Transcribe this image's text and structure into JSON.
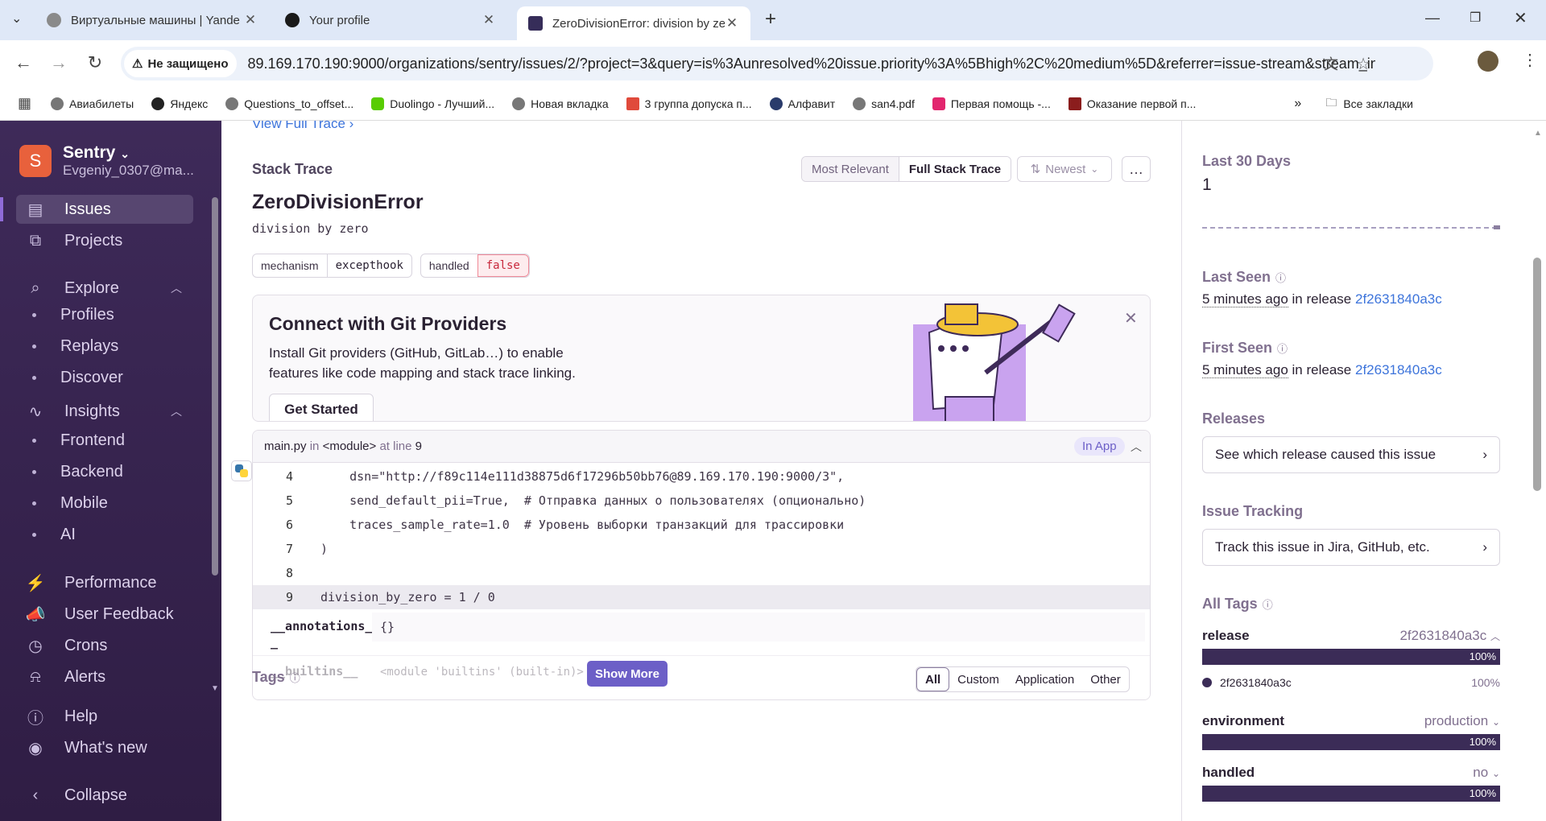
{
  "browser": {
    "tabs": [
      {
        "title": "Виртуальные машины | Yande",
        "active": false
      },
      {
        "title": "Your profile",
        "active": false
      },
      {
        "title": "ZeroDivisionError: division by ze",
        "active": true
      }
    ],
    "insecure_label": "Не защищено",
    "url": "89.169.170.190:9000/organizations/sentry/issues/2/?project=3&query=is%3Aunresolved%20issue.priority%3A%5Bhigh%2C%20medium%5D&referrer=issue-stream&stream_index=...",
    "bookmarks": [
      "Авиабилеты",
      "Яндекс",
      "Questions_to_offset...",
      "Duolingo - Лучший...",
      "Новая вкладка",
      "3 группа допуска п...",
      "Алфавит",
      "san4.pdf",
      "Первая помощь -...",
      "Оказание первой п..."
    ],
    "all_bookmarks": "Все закладки"
  },
  "sidebar": {
    "org_initial": "S",
    "org_name": "Sentry",
    "org_user": "Evgeniy_0307@ma...",
    "issues": "Issues",
    "projects": "Projects",
    "explore": "Explore",
    "explore_items": [
      "Profiles",
      "Replays",
      "Discover"
    ],
    "insights": "Insights",
    "insights_items": [
      "Frontend",
      "Backend",
      "Mobile",
      "AI"
    ],
    "performance": "Performance",
    "user_feedback": "User Feedback",
    "crons": "Crons",
    "alerts": "Alerts",
    "help": "Help",
    "whats_new": "What's new",
    "collapse": "Collapse"
  },
  "main": {
    "view_full_trace": "View Full Trace",
    "stack_trace_label": "Stack Trace",
    "toggle_most_relevant": "Most Relevant",
    "toggle_full_stack": "Full Stack Trace",
    "sort_label": "Newest",
    "error_type": "ZeroDivisionError",
    "error_value": "division by zero",
    "chips": [
      {
        "key": "mechanism",
        "value": "excepthook"
      },
      {
        "key": "handled",
        "value": "false"
      }
    ],
    "git_banner": {
      "title": "Connect with Git Providers",
      "body1": "Install Git providers (GitHub, GitLab…) to enable",
      "body2": "features like code mapping and stack trace linking.",
      "button": "Get Started"
    },
    "frame": {
      "file": "main.py",
      "in": "in",
      "module": "<module>",
      "at_line": "at line",
      "line": "9",
      "in_app": "In App"
    },
    "code_lines": [
      {
        "n": "4",
        "code": "    dsn=\"http://f89c114e111d38875d6f17296b50bb76@89.169.170.190:9000/3\","
      },
      {
        "n": "5",
        "code": "    send_default_pii=True,  # Отправка данных о пользователях (опционально)"
      },
      {
        "n": "6",
        "code": "    traces_sample_rate=1.0  # Уровень выборки транзакций для трассировки"
      },
      {
        "n": "7",
        "code": ")"
      },
      {
        "n": "8",
        "code": ""
      },
      {
        "n": "9",
        "code": "division_by_zero = 1 / 0"
      }
    ],
    "vars": [
      {
        "name": "__annotations_",
        "name2": "_",
        "value": "{}"
      },
      {
        "name": "__builtins__",
        "value": "<module 'builtins' (built-in)>"
      }
    ],
    "show_more": "Show More",
    "tags_label": "Tags",
    "tag_filters": [
      "All",
      "Custom",
      "Application",
      "Other"
    ]
  },
  "right": {
    "last30_label": "Last 30 Days",
    "last30_value": "1",
    "last_seen_label": "Last Seen",
    "last_seen_time": "5 minutes ago",
    "in_release": "in release",
    "release_hash": "2f2631840a3c",
    "first_seen_label": "First Seen",
    "first_seen_time": "5 minutes ago",
    "releases_label": "Releases",
    "releases_button": "See which release caused this issue",
    "tracking_label": "Issue Tracking",
    "tracking_button": "Track this issue in Jira, GitHub, etc.",
    "all_tags_label": "All Tags",
    "tags": [
      {
        "key": "release",
        "value": "2f2631840a3c",
        "pct": "100%"
      },
      {
        "key": "environment",
        "value": "production",
        "pct": "100%"
      },
      {
        "key": "handled",
        "value": "no",
        "pct": "100%"
      }
    ],
    "release_detail": {
      "value": "2f2631840a3c",
      "pct": "100%"
    }
  },
  "colors": {
    "accent": "#6c5fc7",
    "sidebar": "#3e2a59",
    "link": "#3d74db",
    "bar": "#3b2c57"
  }
}
